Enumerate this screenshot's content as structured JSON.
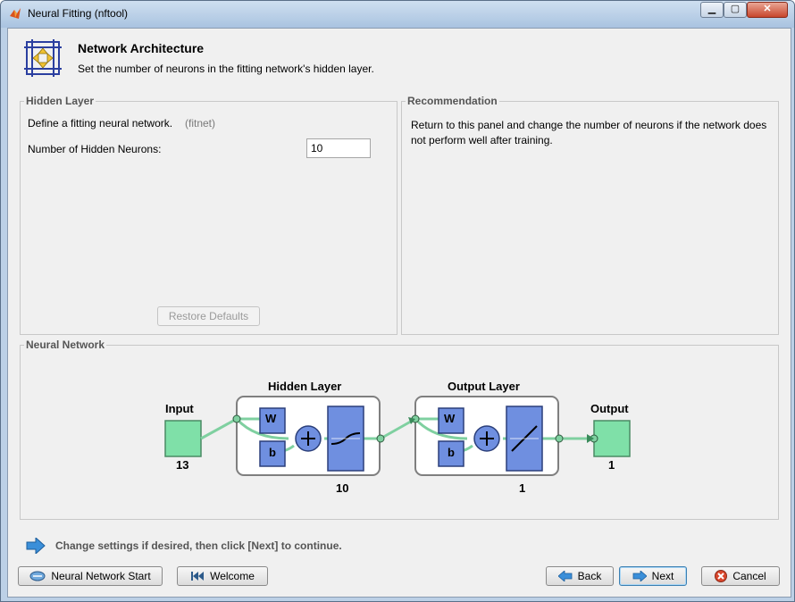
{
  "window": {
    "title": "Neural Fitting (nftool)"
  },
  "header": {
    "title": "Network Architecture",
    "subtitle": "Set the number of neurons in the fitting network's hidden layer."
  },
  "hidden_layer_panel": {
    "title": "Hidden Layer",
    "description": "Define a fitting neural network.",
    "function_hint": "(fitnet)",
    "neurons_label": "Number of Hidden Neurons:",
    "neurons_value": "10",
    "restore_label": "Restore Defaults"
  },
  "recommendation_panel": {
    "title": "Recommendation",
    "text_line1": "Return to this panel and change the number of neurons if the network does",
    "text_line2": "not perform well after training."
  },
  "network_panel": {
    "title": "Neural Network",
    "input_label": "Input",
    "input_size": "13",
    "hidden_label": "Hidden Layer",
    "hidden_size": "10",
    "output_layer_label": "Output Layer",
    "output_layer_size": "1",
    "output_label": "Output",
    "output_size": "1",
    "weight_symbol": "W",
    "bias_symbol": "b"
  },
  "hint": {
    "text": "Change settings  if desired, then click [Next] to continue."
  },
  "footer": {
    "nn_start_label": "Neural Network Start",
    "welcome_label": "Welcome",
    "back_label": "Back",
    "next_label": "Next",
    "cancel_label": "Cancel"
  },
  "colors": {
    "block_green": "#7fe0a8",
    "block_blue": "#6f8fe0",
    "connector": "#7fd0a0"
  }
}
